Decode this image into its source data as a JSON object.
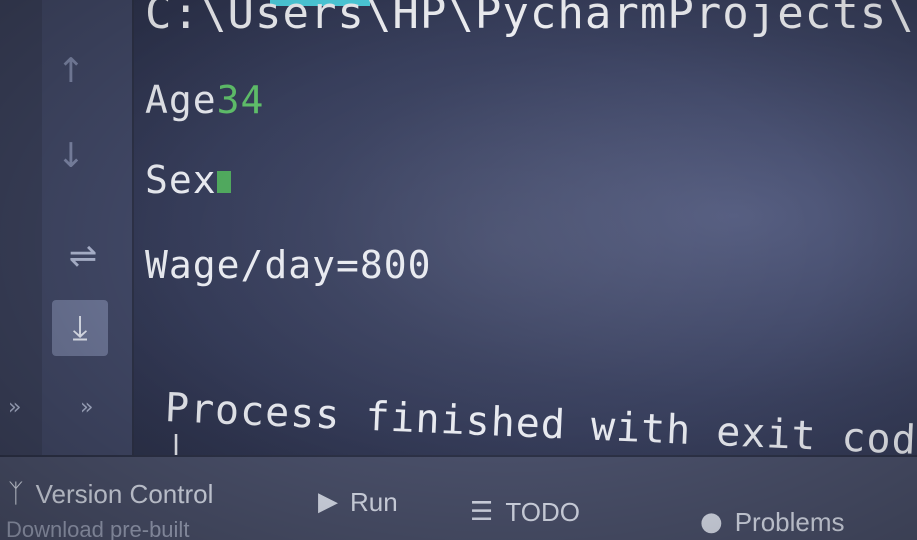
{
  "console": {
    "path_text": "C:\\Users\\HP\\PycharmProjects\\p",
    "age_label": "Age",
    "age_value": "34",
    "sex_label": "Sex",
    "wage_text": "Wage/day=800",
    "process_text": "Process finished with exit code",
    "cursor_text": "|"
  },
  "toolbar": {
    "up_icon": "arrow-up-icon",
    "down_icon": "arrow-down-icon",
    "wrap_icon": "soft-wrap-icon",
    "scroll_icon": "scroll-to-end-icon"
  },
  "bottom_bar": {
    "tabs": [
      {
        "label": "Version Control",
        "icon": "version-control-icon"
      },
      {
        "label": "Run",
        "icon": "run-icon"
      },
      {
        "label": "TODO",
        "icon": "todo-icon"
      },
      {
        "label": "Problems",
        "icon": "problems-icon"
      }
    ],
    "status_text": "Download pre-built"
  },
  "colors": {
    "background": "#3b4260",
    "output_text": "#e8eaf0",
    "input_green": "#5fbf6a",
    "accent_cyan": "#4fd2e2"
  }
}
